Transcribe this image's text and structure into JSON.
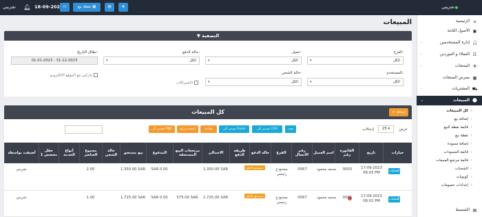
{
  "topbar": {
    "user": "تجريبي",
    "date": "18-09-2023",
    "pos_label": "نقطة بيع",
    "brand": "تجريبي",
    "colors": {
      "bg": "#232b38",
      "accent": "#2f8fd4"
    }
  },
  "sidebar": {
    "items": [
      {
        "label": "الرئيسية",
        "icon": "home-icon"
      },
      {
        "label": "الأصول الثابتة",
        "icon": "assets-icon"
      },
      {
        "label": "إدارة المستخدمين",
        "icon": "users-icon"
      },
      {
        "label": "العملاء و الموردين",
        "icon": "contacts-icon"
      },
      {
        "label": "المنتجات",
        "icon": "box-icon"
      },
      {
        "label": "معرض المنتجات",
        "icon": "gallery-icon"
      },
      {
        "label": "المشتريات",
        "icon": "cart-icon"
      },
      {
        "label": "المبيعات",
        "icon": "sales-icon",
        "active": true
      }
    ],
    "sub_items": [
      {
        "label": "كل المبيعات",
        "active": true
      },
      {
        "label": "إضافة بيع"
      },
      {
        "label": "قائمة نقطة البيع"
      },
      {
        "label": "نقطة بيع"
      },
      {
        "label": "إضافة مسودة"
      },
      {
        "label": "قائمة المسودات"
      },
      {
        "label": "قائمة مرتجع المبيعات"
      },
      {
        "label": "الشحنات"
      },
      {
        "label": "كوبونات"
      },
      {
        "label": "إعدادات خصومات"
      }
    ],
    "bottom_item": {
      "label": "التقسيط",
      "icon": "installments-icon"
    }
  },
  "page": {
    "title": "المبيعات"
  },
  "filters": {
    "header": "التصفية",
    "branch": {
      "label": "الفرع:",
      "value": "الكل"
    },
    "customer": {
      "label": "عميل:",
      "value": "الكل"
    },
    "payment_status": {
      "label": "حالة الدفع:",
      "value": "الكل"
    },
    "date_range": {
      "label": "نطاق التاريخ:",
      "value": "01-01-2023 - 31-12-2023"
    },
    "user": {
      "label": "المستخدم:",
      "value": "الكل"
    },
    "shipping_status": {
      "label": "حالة الشحن:",
      "value": "الكل"
    },
    "subscriptions_label": "الاشتراكات",
    "website_label": "ماركين مع الموقع الالكتروني"
  },
  "sales": {
    "title": "كل المبيعات",
    "add_label": "+ إضافة",
    "show_label": "عرض",
    "page_length": "25",
    "entries_label": "إدخالات",
    "export_buttons": [
      "بحث",
      "تصدير الى CSV",
      "تصدير الى Excel",
      "طباعة",
      "اعمدة مرئية",
      "تصدير الى PDF"
    ],
    "columns": [
      "خيارات",
      "تاريخ",
      "الفاتورة رقم",
      "اسم العميل",
      "رقم الاتصال",
      "الفرع",
      "حالة الدفع",
      "طريقة الدفع",
      "الاجمالي",
      "مرتجعات البيع المستحقة",
      "المدفوع",
      "بيع مستحق",
      "حالة الشحن",
      "مجموع العناصر",
      "أنواع الخدمة",
      "حقل مخصص 1",
      "أضيفت بواسطة"
    ],
    "action_label": "العمليات",
    "rows": [
      {
        "date": "17-09-2023 08:03 PM",
        "invoice": "0003",
        "customer": "محمد محمود",
        "phone": "0567",
        "branch": "مستودع رئيسي",
        "payment_status": "مستحق الدفع",
        "payment_method": "",
        "total": "1,350.00 SAR",
        "return_due": "",
        "paid": "SAR 0.00",
        "sell_due": "1,350.00 SAR",
        "shipping_status": "",
        "total_items": "2.00",
        "service_type": "",
        "custom_field": "",
        "added_by": "تجريبي"
      },
      {
        "date": "17-09-2023 08:02 PM",
        "invoice": "0001",
        "customer": "محمد محمود",
        "phone": "0567",
        "branch": "مستودع رئيسي",
        "payment_status": "مستحق الدفع",
        "payment_method": "",
        "total": "1,725.00 SAR",
        "return_due": "575.00 SAR",
        "paid": "SAR 0.00",
        "sell_due": "1,725.00 SAR",
        "shipping_status": "",
        "total_items": "1.00",
        "service_type": "",
        "custom_field": "",
        "added_by": "تجريبي"
      }
    ]
  }
}
